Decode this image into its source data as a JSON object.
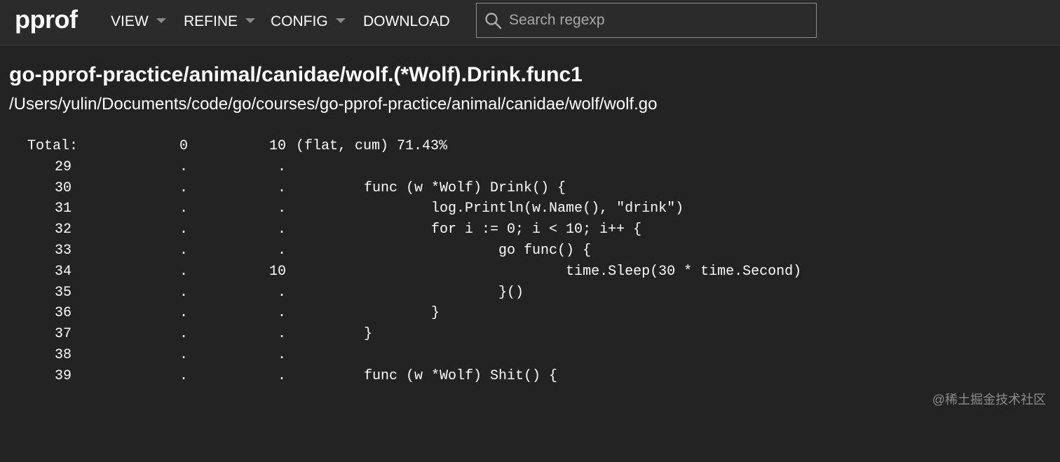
{
  "app": {
    "logo": "pprof"
  },
  "menu": [
    {
      "label": "VIEW",
      "dropdown": true
    },
    {
      "label": "REFINE",
      "dropdown": true
    },
    {
      "label": "CONFIG",
      "dropdown": true
    },
    {
      "label": "DOWNLOAD",
      "dropdown": false
    }
  ],
  "search": {
    "placeholder": "Search regexp",
    "value": "",
    "icon": "search-icon"
  },
  "function": {
    "name": "go-pprof-practice/animal/canidae/wolf.(*Wolf).Drink.func1",
    "file": "/Users/yulin/Documents/code/go/courses/go-pprof-practice/animal/canidae/wolf/wolf.go"
  },
  "source_listing": {
    "total": {
      "label": "Total:",
      "flat": "0",
      "cum": "10",
      "summary": "(flat, cum) 71.43%"
    },
    "rows": [
      {
        "line": "29",
        "flat": ".",
        "cum": ".",
        "code": ""
      },
      {
        "line": "30",
        "flat": ".",
        "cum": ".",
        "code": "      func (w *Wolf) Drink() {"
      },
      {
        "line": "31",
        "flat": ".",
        "cum": ".",
        "code": "              log.Println(w.Name(), \"drink\")"
      },
      {
        "line": "32",
        "flat": ".",
        "cum": ".",
        "code": "              for i := 0; i < 10; i++ {"
      },
      {
        "line": "33",
        "flat": ".",
        "cum": ".",
        "code": "                      go func() {"
      },
      {
        "line": "34",
        "flat": ".",
        "cum": "10",
        "code": "                              time.Sleep(30 * time.Second)"
      },
      {
        "line": "35",
        "flat": ".",
        "cum": ".",
        "code": "                      }()"
      },
      {
        "line": "36",
        "flat": ".",
        "cum": ".",
        "code": "              }"
      },
      {
        "line": "37",
        "flat": ".",
        "cum": ".",
        "code": "      }"
      },
      {
        "line": "38",
        "flat": ".",
        "cum": ".",
        "code": ""
      },
      {
        "line": "39",
        "flat": ".",
        "cum": ".",
        "code": "      func (w *Wolf) Shit() {"
      }
    ]
  },
  "watermark": "@稀土掘金技术社区",
  "colors": {
    "background": "#232323",
    "topbar": "#2b2b2b",
    "text": "#ffffff",
    "caret": "#8a8a8a"
  }
}
